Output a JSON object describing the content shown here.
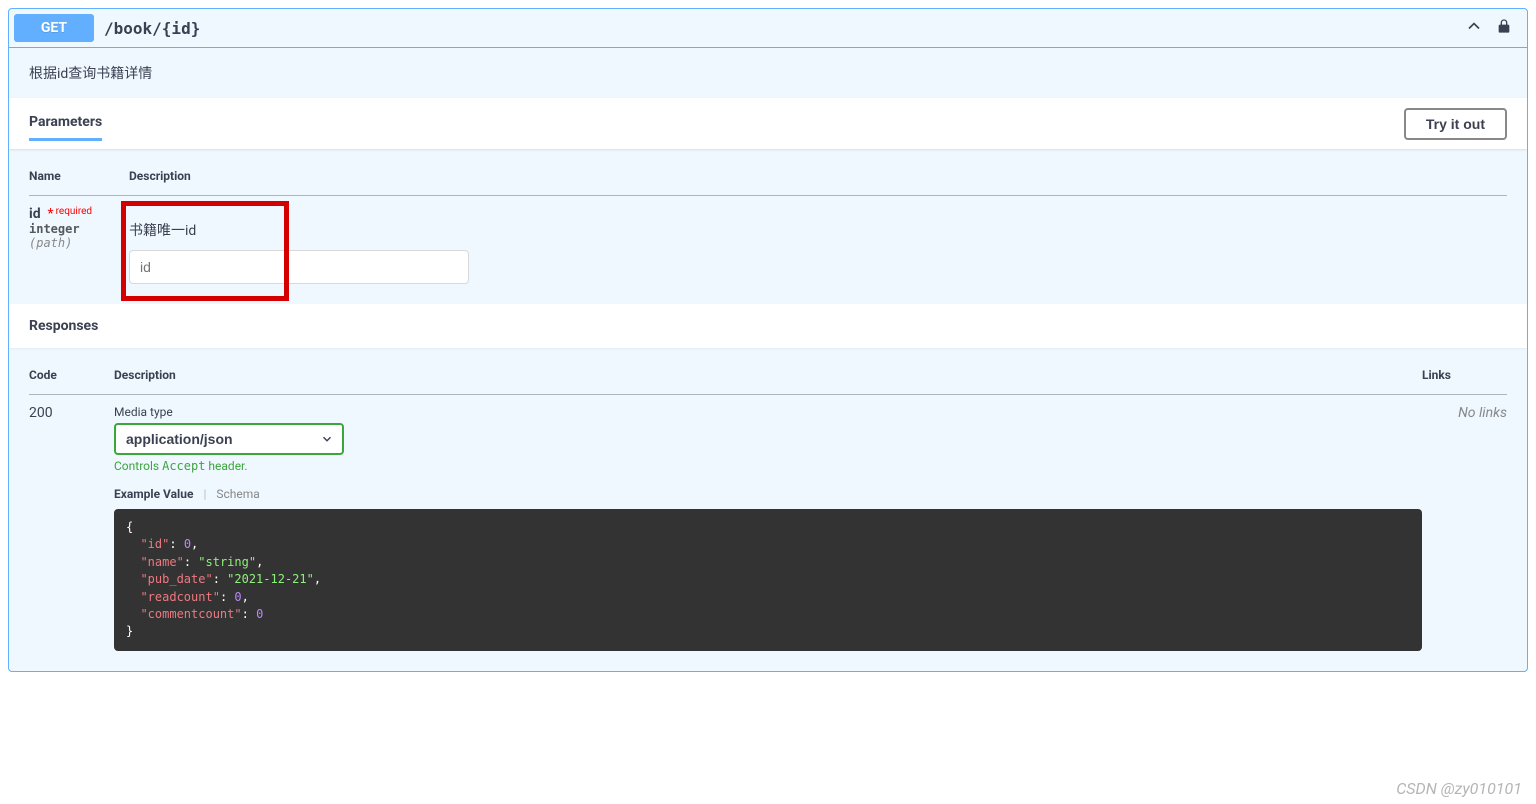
{
  "method": "GET",
  "path": "/book/{id}",
  "summary": "根据id查询书籍详情",
  "tabs": {
    "parameters": "Parameters"
  },
  "try_it_out": "Try it out",
  "param_headers": {
    "name": "Name",
    "description": "Description"
  },
  "param": {
    "name": "id",
    "required_text": "required",
    "type": "integer",
    "in": "(path)",
    "description": "书籍唯一id",
    "placeholder": "id"
  },
  "responses_title": "Responses",
  "resp_headers": {
    "code": "Code",
    "description": "Description",
    "links": "Links"
  },
  "response": {
    "code": "200",
    "media_label": "Media type",
    "media_value": "application/json",
    "accept_hint_pre": "Controls ",
    "accept_hint_mono": "Accept",
    "accept_hint_post": " header.",
    "ex_value": "Example Value",
    "ex_schema": "Schema",
    "no_links": "No links"
  },
  "example": {
    "id_key": "\"id\"",
    "id_val": "0",
    "name_key": "\"name\"",
    "name_val": "\"string\"",
    "pub_key": "\"pub_date\"",
    "pub_val": "\"2021-12-21\"",
    "read_key": "\"readcount\"",
    "read_val": "0",
    "comment_key": "\"commentcount\"",
    "comment_val": "0"
  },
  "watermark": "CSDN @zy010101"
}
